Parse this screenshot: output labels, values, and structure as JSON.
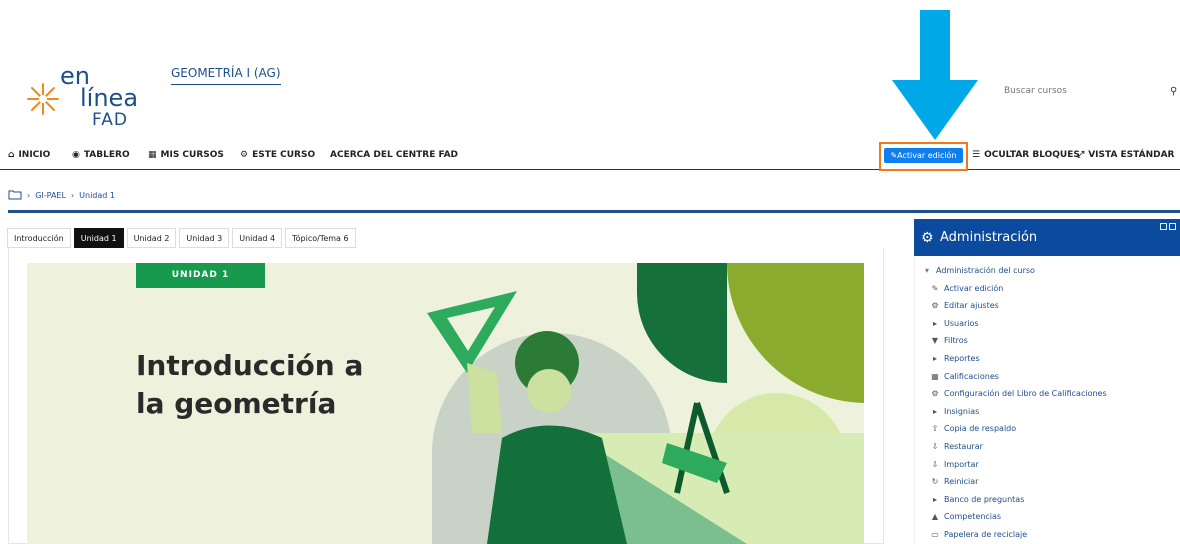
{
  "header": {
    "logo": {
      "word1": "en",
      "word2": "línea",
      "word3": "FAD"
    },
    "course_title": "GEOMETRÍA I (AG)",
    "search": {
      "placeholder": "Buscar cursos"
    }
  },
  "navbar": {
    "items": [
      {
        "label": "INICIO",
        "icon": "home-icon"
      },
      {
        "label": "TABLERO",
        "icon": "dashboard-icon"
      },
      {
        "label": "MIS CURSOS",
        "icon": "briefcase-icon"
      },
      {
        "label": "ESTE CURSO",
        "icon": "sitemap-icon"
      },
      {
        "label": "ACERCA DEL CENTRE FAD",
        "icon": ""
      }
    ],
    "edit_button": "Activar edición",
    "hide_blocks": "OCULTAR BLOQUES",
    "standard_view": "VISTA ESTÁNDAR"
  },
  "breadcrumb": [
    "GI-PAEL",
    "Unidad 1"
  ],
  "tabs": [
    {
      "label": "Introducción",
      "active": false
    },
    {
      "label": "Unidad 1",
      "active": true
    },
    {
      "label": "Unidad 2",
      "active": false
    },
    {
      "label": "Unidad 3",
      "active": false
    },
    {
      "label": "Unidad 4",
      "active": false
    },
    {
      "label": "Tópico/Tema 6",
      "active": false
    }
  ],
  "banner": {
    "badge": "UNIDAD 1",
    "title_line1": "Introducción a",
    "title_line2": "la geometría"
  },
  "admin": {
    "title": "Administración",
    "items": [
      {
        "label": "Administración del curso",
        "icon": "caret-down-icon",
        "level": 0
      },
      {
        "label": "Activar edición",
        "icon": "pencil-icon",
        "level": 1
      },
      {
        "label": "Editar ajustes",
        "icon": "gear-icon",
        "level": 1
      },
      {
        "label": "Usuarios",
        "icon": "caret-right-icon",
        "level": 1
      },
      {
        "label": "Filtros",
        "icon": "filter-icon",
        "level": 1
      },
      {
        "label": "Reportes",
        "icon": "caret-right-icon",
        "level": 1
      },
      {
        "label": "Calificaciones",
        "icon": "table-icon",
        "level": 1
      },
      {
        "label": "Configuración del Libro de Calificaciones",
        "icon": "gear-icon",
        "level": 1
      },
      {
        "label": "Insignias",
        "icon": "caret-right-icon",
        "level": 1
      },
      {
        "label": "Copia de respaldo",
        "icon": "upload-icon",
        "level": 1
      },
      {
        "label": "Restaurar",
        "icon": "download-icon",
        "level": 1
      },
      {
        "label": "Importar",
        "icon": "download-icon",
        "level": 1
      },
      {
        "label": "Reiniciar",
        "icon": "refresh-icon",
        "level": 1
      },
      {
        "label": "Banco de preguntas",
        "icon": "caret-right-icon",
        "level": 1
      },
      {
        "label": "Competencias",
        "icon": "competency-icon",
        "level": 1
      },
      {
        "label": "Papelera de reciclaje",
        "icon": "trash-icon",
        "level": 1
      }
    ]
  },
  "colors": {
    "brand_blue": "#0b4a9c",
    "edit_button": "#0f7ff0",
    "highlight_orange": "#f0781e",
    "arrow_cyan": "#00a8e8",
    "badge_green": "#179a4d"
  }
}
